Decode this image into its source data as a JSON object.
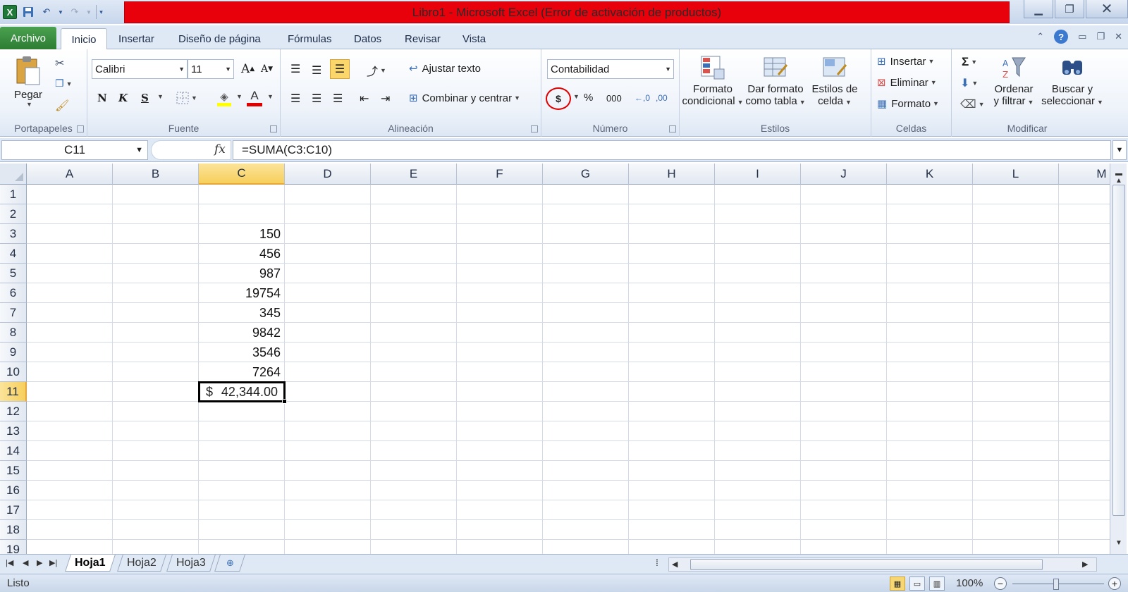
{
  "window": {
    "title": "Libro1  -  Microsoft Excel (Error de activación de productos)",
    "logo_letter": "X"
  },
  "tabs": {
    "archivo": "Archivo",
    "inicio": "Inicio",
    "insertar": "Insertar",
    "diseno": "Diseño de página",
    "formulas": "Fórmulas",
    "datos": "Datos",
    "revisar": "Revisar",
    "vista": "Vista",
    "help": "?"
  },
  "ribbon": {
    "portapapeles": {
      "label": "Portapapeles",
      "pegar": "Pegar"
    },
    "fuente": {
      "label": "Fuente",
      "font_name": "Calibri",
      "font_size": "11",
      "bold": "N",
      "italic": "K",
      "underline": "S",
      "grow": "A",
      "shrink": "A",
      "font_color_letter": "A"
    },
    "alineacion": {
      "label": "Alineación",
      "ajustar": "Ajustar texto",
      "combinar": "Combinar y centrar"
    },
    "numero": {
      "label": "Número",
      "format": "Contabilidad",
      "currency": "$",
      "percent": "%",
      "thousands": "000",
      "inc_decimal": "←,0",
      "dec_decimal": ",00"
    },
    "estilos": {
      "label": "Estilos",
      "formato_cond_1": "Formato",
      "formato_cond_2": "condicional",
      "dar_formato_1": "Dar formato",
      "dar_formato_2": "como tabla",
      "estilos_celda_1": "Estilos de",
      "estilos_celda_2": "celda"
    },
    "celdas": {
      "label": "Celdas",
      "insertar": "Insertar",
      "eliminar": "Eliminar",
      "formato": "Formato"
    },
    "modificar": {
      "label": "Modificar",
      "sigma": "Σ",
      "ordenar_1": "Ordenar",
      "ordenar_2": "y filtrar",
      "buscar_1": "Buscar y",
      "buscar_2": "seleccionar"
    }
  },
  "formula_bar": {
    "name_box": "C11",
    "fx": "fx",
    "formula": "=SUMA(C3:C10)"
  },
  "grid": {
    "columns": [
      "A",
      "B",
      "C",
      "D",
      "E",
      "F",
      "G",
      "H",
      "I",
      "J",
      "K",
      "L",
      "M"
    ],
    "rows": [
      "1",
      "2",
      "3",
      "4",
      "5",
      "6",
      "7",
      "8",
      "9",
      "10",
      "11",
      "12",
      "13",
      "14",
      "15",
      "16",
      "17",
      "18",
      "19"
    ],
    "c_values": [
      "",
      "",
      "150",
      "456",
      "987",
      "19754",
      "345",
      "9842",
      "3546",
      "7264"
    ],
    "active_cell": {
      "currency": "$",
      "amount": "42,344.00"
    }
  },
  "sheets": {
    "hoja1": "Hoja1",
    "hoja2": "Hoja2",
    "hoja3": "Hoja3"
  },
  "status": {
    "text": "Listo",
    "zoom": "100%"
  },
  "colors": {
    "title_error": "#e8000b",
    "archivo_tab": "#2d7d33",
    "selection_header": "#f7cf5b",
    "highlight_circle": "#e00000"
  }
}
